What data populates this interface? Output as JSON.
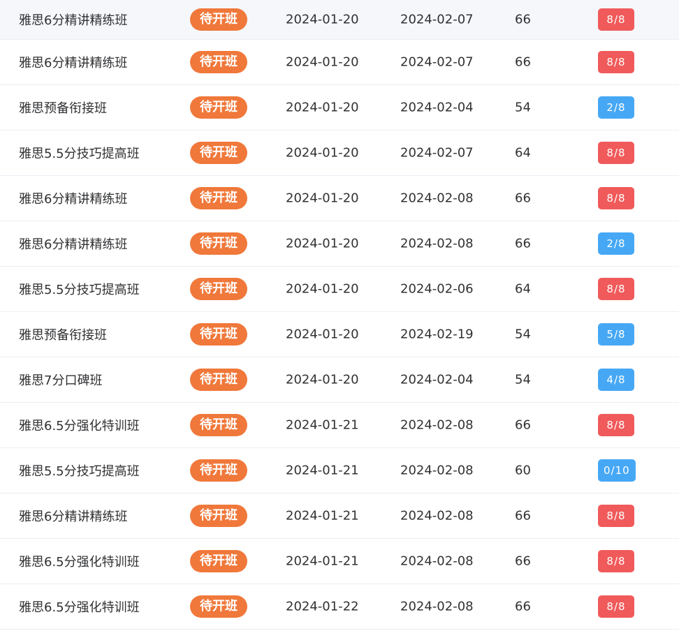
{
  "colors": {
    "status_open_pending": "#f0783a",
    "enroll_full": "#f05a5a",
    "enroll_available": "#46a8f5"
  },
  "rows": [
    {
      "name": "雅思6分精讲精练班",
      "status": "待开班",
      "start": "2024-01-20",
      "end": "2024-02-07",
      "price": "66",
      "enroll": "8/8",
      "enroll_state": "full"
    },
    {
      "name": "雅思6分精讲精练班",
      "status": "待开班",
      "start": "2024-01-20",
      "end": "2024-02-07",
      "price": "66",
      "enroll": "8/8",
      "enroll_state": "full"
    },
    {
      "name": "雅思预备衔接班",
      "status": "待开班",
      "start": "2024-01-20",
      "end": "2024-02-04",
      "price": "54",
      "enroll": "2/8",
      "enroll_state": "available"
    },
    {
      "name": "雅思5.5分技巧提高班",
      "status": "待开班",
      "start": "2024-01-20",
      "end": "2024-02-07",
      "price": "64",
      "enroll": "8/8",
      "enroll_state": "full"
    },
    {
      "name": "雅思6分精讲精练班",
      "status": "待开班",
      "start": "2024-01-20",
      "end": "2024-02-08",
      "price": "66",
      "enroll": "8/8",
      "enroll_state": "full"
    },
    {
      "name": "雅思6分精讲精练班",
      "status": "待开班",
      "start": "2024-01-20",
      "end": "2024-02-08",
      "price": "66",
      "enroll": "2/8",
      "enroll_state": "available"
    },
    {
      "name": "雅思5.5分技巧提高班",
      "status": "待开班",
      "start": "2024-01-20",
      "end": "2024-02-06",
      "price": "64",
      "enroll": "8/8",
      "enroll_state": "full"
    },
    {
      "name": "雅思预备衔接班",
      "status": "待开班",
      "start": "2024-01-20",
      "end": "2024-02-19",
      "price": "54",
      "enroll": "5/8",
      "enroll_state": "available"
    },
    {
      "name": "雅思7分口碑班",
      "status": "待开班",
      "start": "2024-01-20",
      "end": "2024-02-04",
      "price": "54",
      "enroll": "4/8",
      "enroll_state": "available"
    },
    {
      "name": "雅思6.5分强化特训班",
      "status": "待开班",
      "start": "2024-01-21",
      "end": "2024-02-08",
      "price": "66",
      "enroll": "8/8",
      "enroll_state": "full"
    },
    {
      "name": "雅思5.5分技巧提高班",
      "status": "待开班",
      "start": "2024-01-21",
      "end": "2024-02-08",
      "price": "60",
      "enroll": "0/10",
      "enroll_state": "available"
    },
    {
      "name": "雅思6分精讲精练班",
      "status": "待开班",
      "start": "2024-01-21",
      "end": "2024-02-08",
      "price": "66",
      "enroll": "8/8",
      "enroll_state": "full"
    },
    {
      "name": "雅思6.5分强化特训班",
      "status": "待开班",
      "start": "2024-01-21",
      "end": "2024-02-08",
      "price": "66",
      "enroll": "8/8",
      "enroll_state": "full"
    },
    {
      "name": "雅思6.5分强化特训班",
      "status": "待开班",
      "start": "2024-01-22",
      "end": "2024-02-08",
      "price": "66",
      "enroll": "8/8",
      "enroll_state": "full"
    }
  ]
}
